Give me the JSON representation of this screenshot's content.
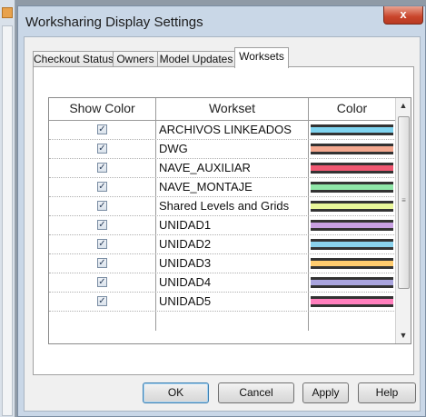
{
  "window": {
    "title": "Worksharing Display Settings",
    "close_glyph": "x"
  },
  "tabs": [
    {
      "label": "Checkout Status",
      "active": false
    },
    {
      "label": "Owners",
      "active": false
    },
    {
      "label": "Model Updates",
      "active": false
    },
    {
      "label": "Worksets",
      "active": true
    }
  ],
  "table": {
    "headers": {
      "show_color": "Show Color",
      "workset": "Workset",
      "color": "Color"
    },
    "check_glyph": "✓",
    "rows": [
      {
        "checked": true,
        "workset": "ARCHIVOS LINKEADOS",
        "color": "#7fd4f0"
      },
      {
        "checked": true,
        "workset": "DWG",
        "color": "#f4a990"
      },
      {
        "checked": true,
        "workset": "NAVE_AUXILIAR",
        "color": "#f05872"
      },
      {
        "checked": true,
        "workset": "NAVE_MONTAJE",
        "color": "#8fe6a8"
      },
      {
        "checked": true,
        "workset": "Shared Levels and Grids",
        "color": "#e9f79a"
      },
      {
        "checked": true,
        "workset": "UNIDAD1",
        "color": "#c8a0e2"
      },
      {
        "checked": true,
        "workset": "UNIDAD2",
        "color": "#8ad2ec"
      },
      {
        "checked": true,
        "workset": "UNIDAD3",
        "color": "#ffcc6e"
      },
      {
        "checked": true,
        "workset": "UNIDAD4",
        "color": "#a9a4de"
      },
      {
        "checked": true,
        "workset": "UNIDAD5",
        "color": "#ff7fbd"
      }
    ],
    "scroll_up_glyph": "▲",
    "scroll_down_glyph": "▼",
    "scroll_grip_glyph": "≡"
  },
  "buttons": {
    "ok": "OK",
    "cancel": "Cancel",
    "apply": "Apply",
    "help": "Help"
  }
}
